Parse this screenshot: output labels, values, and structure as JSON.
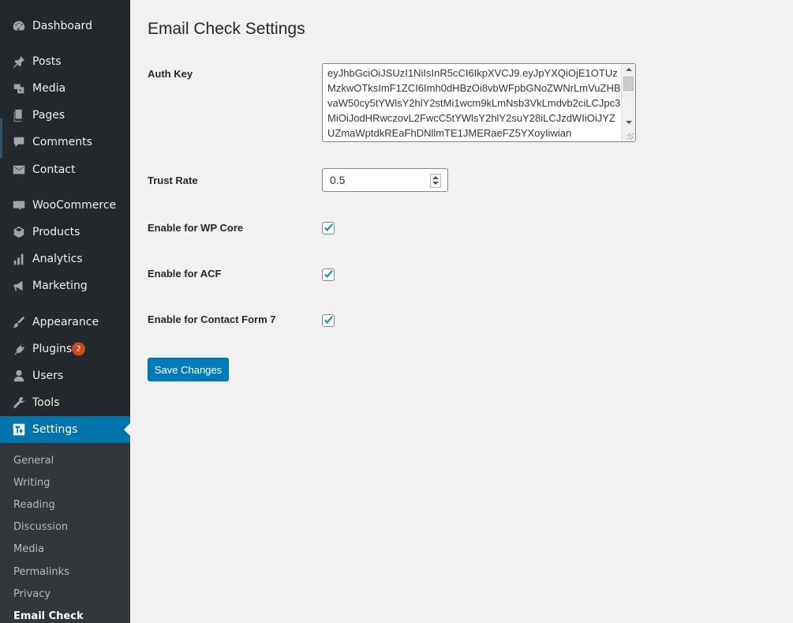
{
  "sidebar": {
    "items": [
      {
        "label": "Dashboard",
        "icon": "dashboard-icon"
      },
      {
        "label": "Posts",
        "icon": "pushpin-icon"
      },
      {
        "label": "Media",
        "icon": "media-icon"
      },
      {
        "label": "Pages",
        "icon": "pages-icon"
      },
      {
        "label": "Comments",
        "icon": "comment-icon"
      },
      {
        "label": "Contact",
        "icon": "envelope-icon"
      },
      {
        "label": "WooCommerce",
        "icon": "woocommerce-icon"
      },
      {
        "label": "Products",
        "icon": "box-icon"
      },
      {
        "label": "Analytics",
        "icon": "bar-chart-icon"
      },
      {
        "label": "Marketing",
        "icon": "megaphone-icon"
      },
      {
        "label": "Appearance",
        "icon": "paintbrush-icon"
      },
      {
        "label": "Plugins",
        "icon": "plug-icon",
        "badge": "2"
      },
      {
        "label": "Users",
        "icon": "user-icon"
      },
      {
        "label": "Tools",
        "icon": "wrench-icon"
      },
      {
        "label": "Settings",
        "icon": "settings-icon"
      }
    ],
    "submenu": [
      "General",
      "Writing",
      "Reading",
      "Discussion",
      "Media",
      "Permalinks",
      "Privacy",
      "Email Check"
    ]
  },
  "page": {
    "title": "Email Check Settings",
    "auth_key_label": "Auth Key",
    "auth_key_value": "eyJhbGciOiJSUzI1NiIsInR5cCI6IkpXVCJ9.eyJpYXQiOjE1OTUzMzkwOTksImF1ZCI6Imh0dHBzOi8vbWFpbGNoZWNrLmVuZHBvaW50cy5tYWlsY2hlY2stMi1wcm9kLmNsb3VkLmdvb2ciLCJpc3MiOiJodHRwczovL2FwcC5tYWlsY2hlY2suY28iLCJzdWIiOiJYZUZmaWptdkREaFhDNllmTE1JMERaeFZ5YXoyIiwian",
    "trust_rate_label": "Trust Rate",
    "trust_rate_value": "0.5",
    "checkboxes": [
      {
        "label": "Enable for WP Core",
        "checked": true
      },
      {
        "label": "Enable for ACF",
        "checked": true
      },
      {
        "label": "Enable for Contact Form 7",
        "checked": true
      }
    ],
    "save_label": "Save Changes"
  },
  "colors": {
    "sidebar_bg": "#23282d",
    "submenu_bg": "#32373c",
    "active": "#0073aa",
    "button": "#007cba",
    "badge": "#ca4a1f",
    "checkmark": "#1e8cbe"
  }
}
